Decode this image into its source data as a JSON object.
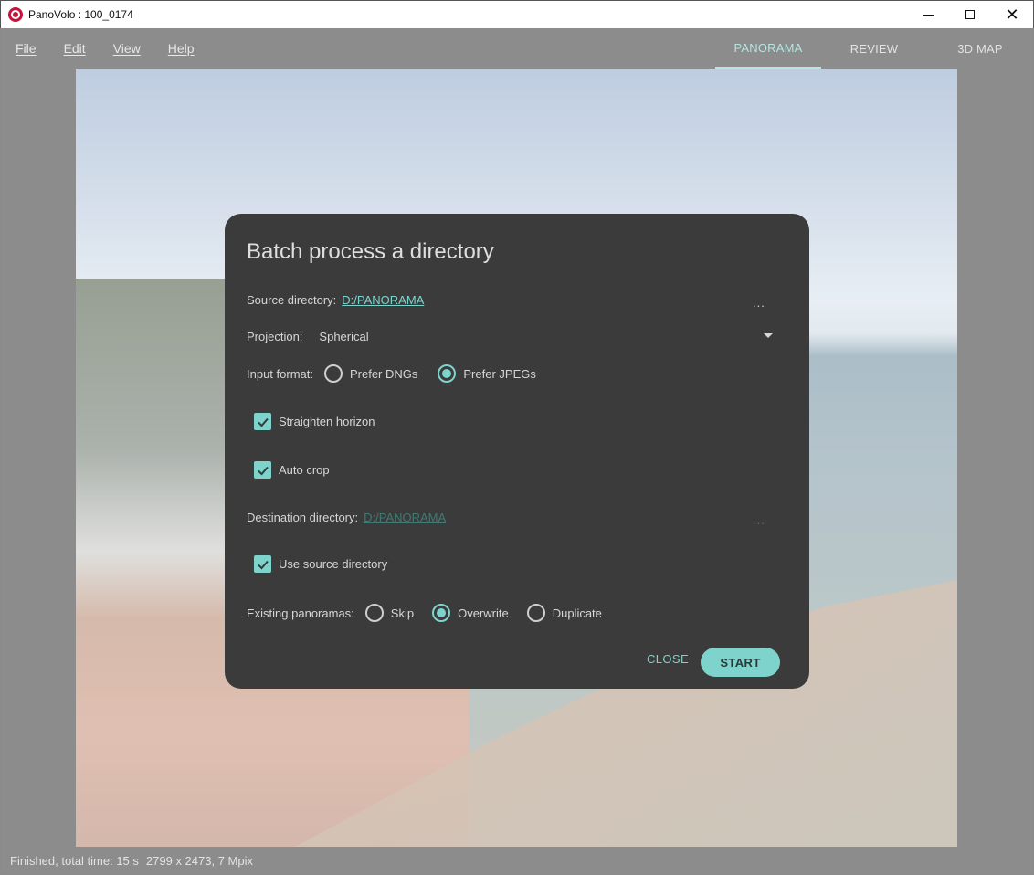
{
  "window": {
    "title": "PanoVolo : 100_0174"
  },
  "menu": {
    "items": [
      "File",
      "Edit",
      "View",
      "Help"
    ]
  },
  "tabs": [
    {
      "label": "PANORAMA",
      "active": true
    },
    {
      "label": "REVIEW",
      "active": false
    },
    {
      "label": "3D MAP",
      "active": false
    }
  ],
  "status": {
    "message": "Finished, total time: 15 s",
    "image_info": "2799 x 2473, 7 Mpix"
  },
  "dialog": {
    "title": "Batch process a directory",
    "source": {
      "label": "Source directory:",
      "value": "D:/PANORAMA",
      "browse": "..."
    },
    "projection": {
      "label": "Projection:",
      "value": "Spherical"
    },
    "input_format": {
      "label": "Input format:",
      "options": [
        {
          "label": "Prefer DNGs",
          "selected": false
        },
        {
          "label": "Prefer JPEGs",
          "selected": true
        }
      ]
    },
    "straighten": {
      "label": "Straighten horizon",
      "checked": true
    },
    "autocrop": {
      "label": "Auto crop",
      "checked": true
    },
    "destination": {
      "label": "Destination directory:",
      "value": "D:/PANORAMA",
      "browse": "...",
      "disabled": true
    },
    "use_source": {
      "label": "Use source directory",
      "checked": true
    },
    "existing": {
      "label": "Existing panoramas:",
      "options": [
        {
          "label": "Skip",
          "selected": false
        },
        {
          "label": "Overwrite",
          "selected": true
        },
        {
          "label": "Duplicate",
          "selected": false
        }
      ]
    },
    "close_label": "CLOSE",
    "start_label": "START"
  },
  "colors": {
    "accent": "#7ed3cc",
    "dialog_bg": "#3b3b3b",
    "brand": "#c4163b"
  }
}
